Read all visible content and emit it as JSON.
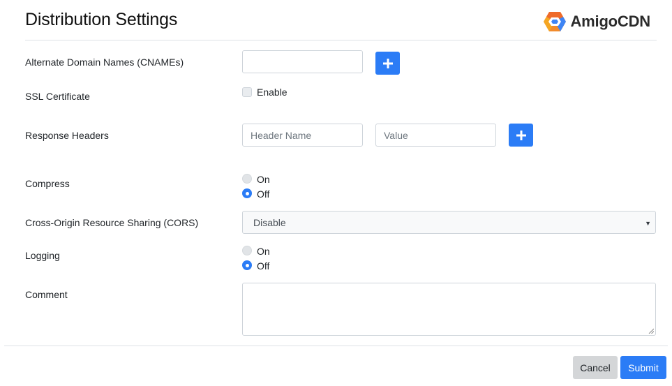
{
  "header": {
    "title": "Distribution Settings",
    "brand": "AmigoCDN",
    "brand_icon": "hexagon-logo-icon"
  },
  "fields": {
    "cnames": {
      "label": "Alternate Domain Names (CNAMEs)",
      "value": "",
      "add_icon": "plus-icon"
    },
    "ssl": {
      "label": "SSL Certificate",
      "option_label": "Enable",
      "checked": false
    },
    "headers": {
      "label": "Response Headers",
      "name_placeholder": "Header Name",
      "value_placeholder": "Value",
      "add_icon": "plus-icon"
    },
    "compress": {
      "label": "Compress",
      "on_label": "On",
      "off_label": "Off",
      "selected": "Off"
    },
    "cors": {
      "label": "Cross-Origin Resource Sharing (CORS)",
      "selected": "Disable"
    },
    "logging": {
      "label": "Logging",
      "on_label": "On",
      "off_label": "Off",
      "selected": "Off"
    },
    "comment": {
      "label": "Comment",
      "value": ""
    }
  },
  "footer": {
    "cancel_label": "Cancel",
    "submit_label": "Submit"
  },
  "colors": {
    "primary": "#2b7cf6",
    "secondary": "#d4d6d8",
    "border": "#ced4da"
  }
}
